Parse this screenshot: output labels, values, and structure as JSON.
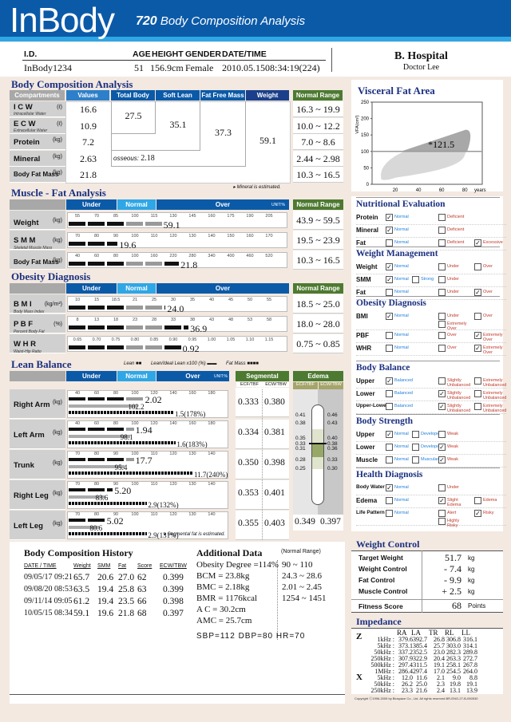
{
  "header": {
    "logo": "InBody",
    "model": "720",
    "title": "Body Composition Analysis"
  },
  "id_bar": {
    "labels": [
      "I.D.",
      "AGE",
      "HEIGHT",
      "GENDER",
      "DATE/TIME"
    ],
    "id": "InBody1234",
    "age": "51",
    "height": "156.9cm",
    "gender": "Female",
    "datetime": "2010.05.1508:34:19(224)",
    "hospital": "B. Hospital",
    "doctor": "Doctor Lee"
  },
  "bca": {
    "title": "Body Composition Analysis",
    "headers": [
      "Compartments",
      "Values",
      "Total Body Water",
      "Soft Lean Mass",
      "Fat Free Mass",
      "Weight",
      "Normal Range"
    ],
    "rows": [
      {
        "name": "I C W",
        "sub": "Intracellular Water",
        "unit": "(ℓ)",
        "value": "16.6",
        "range": "16.3 ~ 19.9"
      },
      {
        "name": "E C W",
        "sub": "Extracellular Water",
        "unit": "(ℓ)",
        "value": "10.9",
        "range": "10.0 ~ 12.2"
      },
      {
        "name": "Protein",
        "sub": "",
        "unit": "(kg)",
        "value": "7.2",
        "range": "7.0 ~ 8.6"
      },
      {
        "name": "Mineral",
        "sub": "",
        "unit": "(kg)",
        "value": "2.63",
        "range": "2.44 ~ 2.98"
      },
      {
        "name": "Body Fat Mass",
        "sub": "",
        "unit": "(kg)",
        "value": "21.8",
        "range": "10.3 ~ 16.5"
      }
    ],
    "tbw": "27.5",
    "slm": "35.1",
    "ffm": "37.3",
    "weight": "59.1",
    "osseous_label": "osseous:",
    "osseous": "2.18",
    "note": "▸ Mineral is estimated."
  },
  "mfa": {
    "title": "Muscle - Fat Analysis",
    "bands": [
      "Under",
      "Normal",
      "Over"
    ],
    "unit": "UNIT:%",
    "range_header": "Normal Range",
    "rows": [
      {
        "name": "Weight",
        "sub": "",
        "unit": "(kg)",
        "ticks": [
          "55",
          "70",
          "85",
          "100",
          "115",
          "130",
          "145",
          "160",
          "175",
          "190",
          "205"
        ],
        "value": "59.1",
        "pct": 115,
        "range": "43.9 ~ 59.5"
      },
      {
        "name": "S M M",
        "sub": "Skeletal Muscle Mass",
        "unit": "(kg)",
        "ticks": [
          "70",
          "80",
          "90",
          "100",
          "110",
          "120",
          "130",
          "140",
          "150",
          "160",
          "170"
        ],
        "value": "19.6",
        "pct": 91,
        "range": "19.5 ~ 23.9"
      },
      {
        "name": "Body Fat Mass",
        "sub": "",
        "unit": "(kg)",
        "ticks": [
          "40",
          "60",
          "80",
          "100",
          "160",
          "220",
          "280",
          "340",
          "400",
          "460",
          "520"
        ],
        "value": "21.8",
        "pct": 170,
        "range": "10.3 ~ 16.5"
      }
    ]
  },
  "obesity": {
    "title": "Obesity Diagnosis",
    "bands": [
      "Under",
      "Normal",
      "Over"
    ],
    "range_header": "Normal Range",
    "rows": [
      {
        "name": "B M I",
        "sub": "Body Mass Index",
        "unit": "(kg/m²)",
        "ticks": [
          "10",
          "15",
          "18.5",
          "21",
          "25",
          "30",
          "35",
          "40",
          "45",
          "50",
          "55"
        ],
        "value": "24.0",
        "pct_index": 4.6,
        "range": "18.5 ~ 25.0"
      },
      {
        "name": "P B F",
        "sub": "Percent Body Fat",
        "unit": "(%)",
        "ticks": [
          "8",
          "13",
          "18",
          "23",
          "28",
          "33",
          "38",
          "43",
          "48",
          "53",
          "58"
        ],
        "value": "36.9",
        "pct_index": 5.8,
        "range": "18.0 ~ 28.0"
      },
      {
        "name": "W H R",
        "sub": "Waist-Hip Ratio",
        "unit": "",
        "ticks": [
          "0.65",
          "0.70",
          "0.75",
          "0.80",
          "0.85",
          "0.90",
          "0.95",
          "1.00",
          "1.05",
          "1.10",
          "1.15"
        ],
        "value": "0.92",
        "pct_index": 5.4,
        "range": "0.75 ~ 0.85"
      }
    ]
  },
  "lean": {
    "title": "Lean Balance",
    "legend": [
      "Lean",
      "Lean/Ideal Lean x100 (%)",
      "Fat Mass"
    ],
    "bands": [
      "Under",
      "Normal",
      "Over"
    ],
    "unit": "UNIT:%",
    "seg_header": "Segmental Edema",
    "edema_header": "Edema",
    "cols": [
      "ECF/TBF",
      "ECW/TBW"
    ],
    "rows": [
      {
        "name": "Right Arm",
        "unit": "(kg)",
        "ticks": [
          "40",
          "60",
          "80",
          "100",
          "120",
          "140",
          "160",
          "180"
        ],
        "lean": "2.02",
        "lean_idx": 3.9,
        "ideal": "102.2",
        "ideal_idx": 3.6,
        "fat": "1.5(178%)",
        "fat_idx": 5.5,
        "ecf": "0.333",
        "ecw": "0.380"
      },
      {
        "name": "Left Arm",
        "unit": "(kg)",
        "ticks": [
          "40",
          "60",
          "80",
          "100",
          "120",
          "140",
          "160",
          "180"
        ],
        "lean": "1.94",
        "lean_idx": 3.4,
        "ideal": "98.1",
        "ideal_idx": 3.2,
        "fat": "1.6(183%)",
        "fat_idx": 5.6,
        "ecf": "0.334",
        "ecw": "0.381"
      },
      {
        "name": "Trunk",
        "unit": "(kg)",
        "ticks": [
          "70",
          "80",
          "90",
          "100",
          "110",
          "120",
          "130",
          "140"
        ],
        "lean": "17.7",
        "lean_idx": 3.4,
        "ideal": "95.4",
        "ideal_idx": 2.9,
        "fat": "11.7(240%)",
        "fat_idx": 6.5,
        "ecf": "0.350",
        "ecw": "0.398"
      },
      {
        "name": "Right Leg",
        "unit": "(kg)",
        "ticks": [
          "70",
          "80",
          "90",
          "100",
          "110",
          "120",
          "130",
          "140"
        ],
        "lean": "5.20",
        "lean_idx": 2.3,
        "ideal": "83.6",
        "ideal_idx": 1.9,
        "fat": "2.9(132%)",
        "fat_idx": 4.1,
        "ecf": "0.353",
        "ecw": "0.401"
      },
      {
        "name": "Left Leg",
        "unit": "(kg)",
        "ticks": [
          "70",
          "80",
          "90",
          "100",
          "110",
          "120",
          "130",
          "140"
        ],
        "lean": "5.02",
        "lean_idx": 1.9,
        "ideal": "80.6",
        "ideal_idx": 1.6,
        "fat": "2.9(131%)",
        "fat_idx": 4.1,
        "ecf": "0.355",
        "ecw": "0.403"
      }
    ],
    "edema_left_ticks": [
      "0.41",
      "0.38",
      "0.35",
      "0.33",
      "0.31",
      "0.28",
      "0.25"
    ],
    "edema_right_ticks": [
      "0.46",
      "0.43",
      "0.40",
      "0.38",
      "0.36",
      "0.33",
      "0.30"
    ],
    "edema_ecf": "0.349",
    "edema_ecw": "0.397",
    "note": "▸ Segmental fat is estimated."
  },
  "history": {
    "title": "Body Composition History",
    "headers": [
      "DATE / TIME",
      "Weight",
      "SMM",
      "Fat",
      "Score",
      "ECW/TBW"
    ],
    "rows": [
      [
        "09/05/17 09:21",
        "65.7",
        "20.6",
        "27.0",
        "62",
        "0.399"
      ],
      [
        "09/08/20 08:53",
        "63.5",
        "19.4",
        "25.8",
        "63",
        "0.399"
      ],
      [
        "09/11/14 09:05",
        "61.2",
        "19.4",
        "23.5",
        "66",
        "0.398"
      ],
      [
        "10/05/15 08:34",
        "59.1",
        "19.6",
        "21.8",
        "68",
        "0.397"
      ]
    ]
  },
  "additional": {
    "title": "Additional Data",
    "range_header": "(Normal Range)",
    "items": [
      [
        "Obesity Degree =114%",
        "90 ~ 110"
      ],
      [
        "BCM = 23.8kg",
        "24.3 ~ 28.6"
      ],
      [
        "BMC = 2.18kg",
        "2.01 ~ 2.45"
      ],
      [
        "BMR = 1176kcal",
        "1254 ~ 1451"
      ],
      [
        "A  C = 30.2cm",
        ""
      ],
      [
        "AMC = 25.7cm",
        ""
      ]
    ],
    "vitals": "SBP=112  DBP=80  HR=70"
  },
  "vfa": {
    "title": "Visceral Fat Area",
    "ylabel": "VFA(cm²)",
    "xlabel": "years",
    "value": "121.5"
  },
  "chart_data": {
    "type": "area",
    "title": "Visceral Fat Area",
    "xlabel": "years",
    "ylabel": "VFA(cm²)",
    "x_ticks": [
      "20",
      "40",
      "60",
      "80"
    ],
    "y_ticks": [
      "0",
      "50",
      "100",
      "150",
      "200",
      "250"
    ],
    "ylim": [
      0,
      250
    ],
    "xlim": [
      0,
      95
    ],
    "threshold": 100,
    "point": {
      "age": 51,
      "value": 121.5,
      "label": "*121.5"
    }
  },
  "nutritional": {
    "title": "Nutritional Evaluation",
    "rows": [
      {
        "k": "Protein",
        "opts": [
          [
            "Normal",
            true,
            "b"
          ],
          [
            "Deficient",
            false,
            "r"
          ]
        ]
      },
      {
        "k": "Mineral",
        "opts": [
          [
            "Normal",
            true,
            "b"
          ],
          [
            "Deficient",
            false,
            "r"
          ]
        ]
      },
      {
        "k": "Fat",
        "opts": [
          [
            "Normal",
            false,
            "b"
          ],
          [
            "Deficient",
            false,
            "r"
          ],
          [
            "Excessive",
            true,
            "r"
          ]
        ]
      }
    ]
  },
  "weight_mgmt": {
    "title": "Weight Management",
    "rows": [
      {
        "k": "Weight",
        "opts": [
          [
            "Normal",
            true,
            "b"
          ],
          [
            "Under",
            false,
            "r"
          ],
          [
            "Over",
            false,
            "r"
          ]
        ]
      },
      {
        "k": "SMM",
        "opts": [
          [
            "Normal",
            true,
            "b"
          ],
          [
            "Strong",
            false,
            "b"
          ],
          [
            "Under",
            false,
            "r"
          ]
        ]
      },
      {
        "k": "Fat",
        "opts": [
          [
            "Normal",
            false,
            "b"
          ],
          [
            "Under",
            false,
            "r"
          ],
          [
            "Over",
            true,
            "r"
          ]
        ]
      }
    ]
  },
  "obesity_dx": {
    "title": "Obesity Diagnosis",
    "rows": [
      {
        "k": "BMI",
        "opts": [
          [
            "Normal",
            true,
            "b"
          ],
          [
            "Under",
            false,
            "r"
          ],
          [
            "Over",
            false,
            "r"
          ],
          [
            "Extremely Over",
            false,
            "r"
          ]
        ]
      },
      {
        "k": "PBF",
        "opts": [
          [
            "Normal",
            false,
            "b"
          ],
          [
            "Over",
            false,
            "r"
          ],
          [
            "Extremely Over",
            true,
            "r"
          ]
        ]
      },
      {
        "k": "WHR",
        "opts": [
          [
            "Normal",
            false,
            "b"
          ],
          [
            "Over",
            false,
            "r"
          ],
          [
            "Extremely Over",
            true,
            "r"
          ]
        ]
      }
    ]
  },
  "body_balance": {
    "title": "Body Balance",
    "rows": [
      {
        "k": "Upper",
        "opts": [
          [
            "Balanced",
            true,
            "b"
          ],
          [
            "Slightly Unbalanced",
            false,
            "r"
          ],
          [
            "Extremely Unbalanced",
            false,
            "r"
          ]
        ]
      },
      {
        "k": "Lower",
        "opts": [
          [
            "Balanced",
            false,
            "b"
          ],
          [
            "Slightly Unbalanced",
            true,
            "r"
          ],
          [
            "Extremely Unbalanced",
            false,
            "r"
          ]
        ]
      },
      {
        "k": "Upper-Lower",
        "opts": [
          [
            "Balanced",
            false,
            "b"
          ],
          [
            "Slightly Unbalanced",
            true,
            "r"
          ],
          [
            "Extremely Unbalanced",
            false,
            "r"
          ]
        ]
      }
    ]
  },
  "body_strength": {
    "title": "Body Strength",
    "rows": [
      {
        "k": "Upper",
        "opts": [
          [
            "Normal",
            true,
            "b"
          ],
          [
            "Developed",
            false,
            "b"
          ],
          [
            "Weak",
            false,
            "r"
          ]
        ]
      },
      {
        "k": "Lower",
        "opts": [
          [
            "Normal",
            false,
            "b"
          ],
          [
            "Developed",
            false,
            "b"
          ],
          [
            "Weak",
            true,
            "r"
          ]
        ]
      },
      {
        "k": "Muscle",
        "opts": [
          [
            "Normal",
            false,
            "b"
          ],
          [
            "Muscular",
            false,
            "b"
          ],
          [
            "Weak",
            true,
            "r"
          ]
        ]
      }
    ]
  },
  "health_dx": {
    "title": "Health Diagnosis",
    "rows": [
      {
        "k": "Body Water",
        "opts": [
          [
            "Normal",
            true,
            "b"
          ],
          [
            "Under",
            false,
            "r"
          ]
        ]
      },
      {
        "k": "Edema",
        "opts": [
          [
            "Normal",
            false,
            "b"
          ],
          [
            "Slight Edema",
            true,
            "r"
          ],
          [
            "Edema",
            false,
            "r"
          ]
        ]
      },
      {
        "k": "Life Pattern",
        "opts": [
          [
            "Normal",
            false,
            "b"
          ],
          [
            "Alert",
            false,
            "r"
          ],
          [
            "Risky",
            true,
            "r"
          ],
          [
            "Highly Risky",
            false,
            "r"
          ]
        ]
      }
    ]
  },
  "weight_control": {
    "title": "Weight Control",
    "rows": [
      [
        "Target Weight",
        "51.7",
        "kg"
      ],
      [
        "Weight Control",
        "- 7.4",
        "kg"
      ],
      [
        "Fat Control",
        "- 9.9",
        "kg"
      ],
      [
        "Muscle Control",
        "+ 2.5",
        "kg"
      ]
    ],
    "fitness": [
      "Fitness Score",
      "68",
      "Points"
    ]
  },
  "impedance": {
    "title": "Impedance",
    "cols": [
      "RA",
      "LA",
      "TR",
      "RL",
      "LL"
    ],
    "z": [
      [
        "1kHz",
        "379.6",
        "392.7",
        "26.8",
        "306.8",
        "316.1"
      ],
      [
        "5kHz",
        "373.1",
        "385.4",
        "25.7",
        "303.0",
        "314.1"
      ],
      [
        "50kHz",
        "337.2",
        "352.5",
        "23.0",
        "282.3",
        "289.8"
      ],
      [
        "250kHz",
        "307.9",
        "322.9",
        "20.4",
        "263.3",
        "272.7"
      ],
      [
        "500kHz",
        "297.4",
        "311.5",
        "19.1",
        "258.1",
        "267.8"
      ],
      [
        "1MHz",
        "286.4",
        "297.4",
        "17.0",
        "254.5",
        "264.0"
      ]
    ],
    "x": [
      [
        "5kHz",
        "12.0",
        "11.6",
        "2.1",
        "9.0",
        "8.8"
      ],
      [
        "50kHz",
        "26.2",
        "25.0",
        "2.3",
        "19.8",
        "19.1"
      ],
      [
        "250kHz",
        "23.3",
        "21.6",
        "2.4",
        "13.1",
        "13.9"
      ]
    ]
  },
  "copyright": "Copyright ⓒ1996-2005 by Biospace Co., Ltd. All rights reserved.BR-ENG-27-B-050530"
}
